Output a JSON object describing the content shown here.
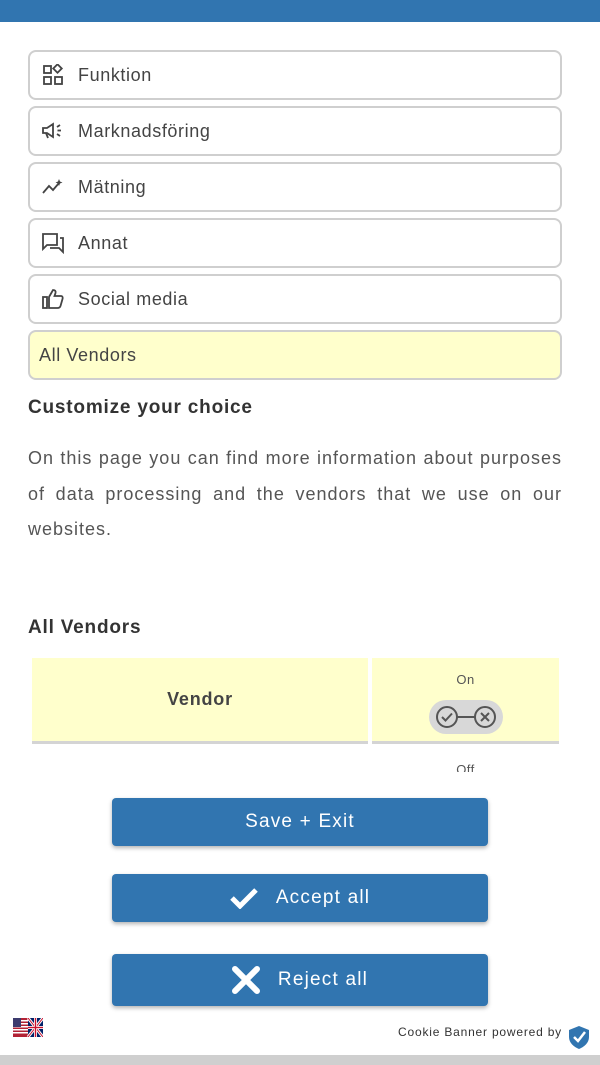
{
  "colors": {
    "accent": "#3175b0",
    "highlight": "#ffffcc",
    "border": "#cfcfcf"
  },
  "categories": [
    {
      "label": "Funktion",
      "icon": "widgets-icon"
    },
    {
      "label": "Marknadsföring",
      "icon": "megaphone-icon"
    },
    {
      "label": "Mätning",
      "icon": "sparkline-icon"
    },
    {
      "label": "Annat",
      "icon": "chat-icon"
    },
    {
      "label": "Social media",
      "icon": "thumbs-up-icon"
    },
    {
      "label": "All Vendors",
      "active": true
    }
  ],
  "customize": {
    "title": "Customize your choice",
    "text": "On this page you can find more information about purposes of data processing and the vendors that we use on our websites."
  },
  "vendors": {
    "title": "All Vendors",
    "col_vendor": "Vendor",
    "col_on": "On",
    "col_off": "Off"
  },
  "buttons": {
    "save": "Save + Exit",
    "accept": "Accept all",
    "reject": "Reject all"
  },
  "footer": {
    "powered_by": "Cookie Banner powered by"
  }
}
